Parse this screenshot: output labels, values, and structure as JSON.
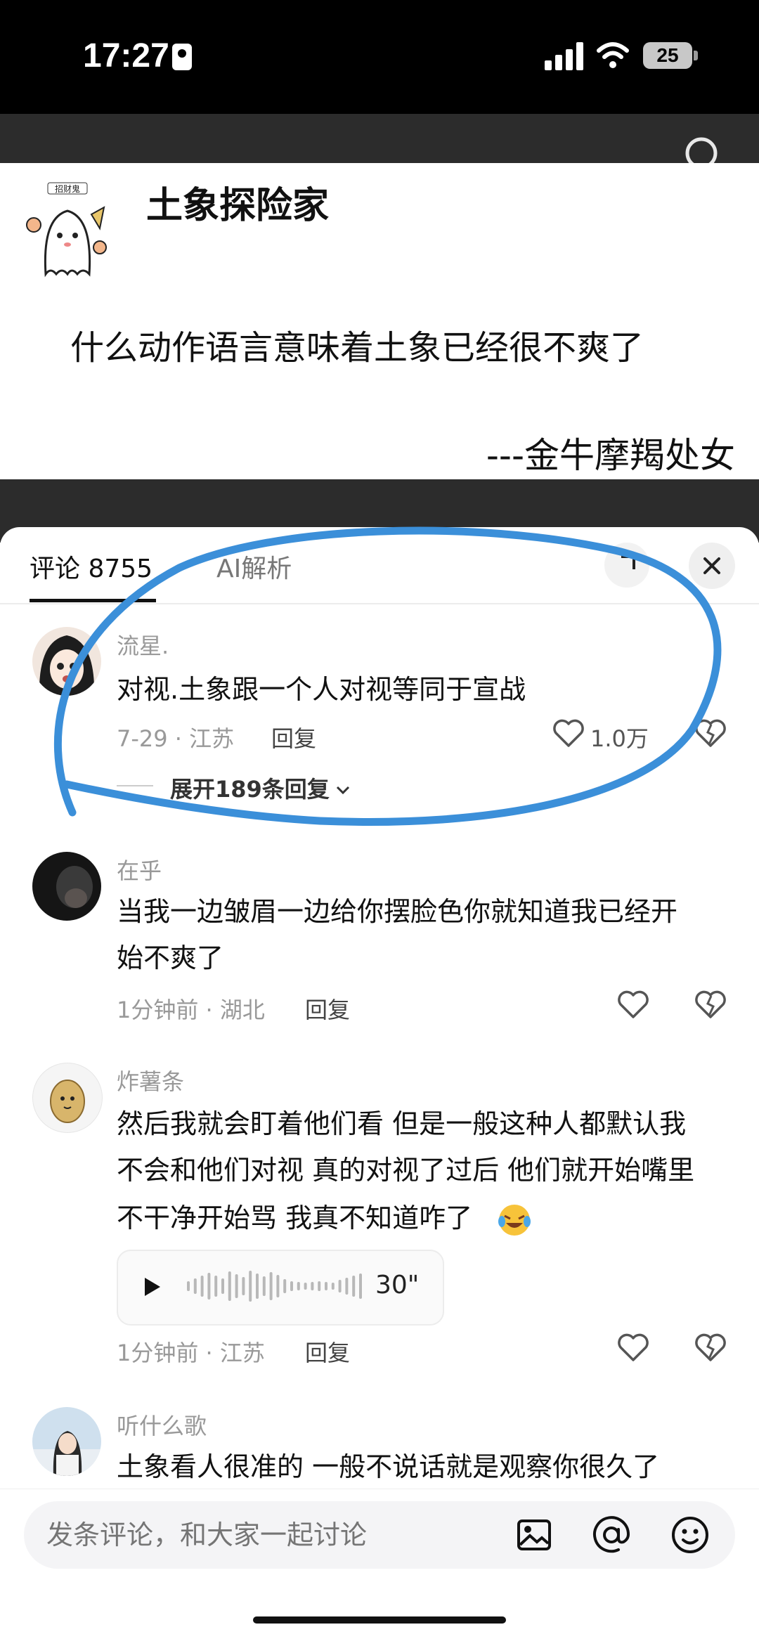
{
  "status_bar": {
    "time": "17:27",
    "battery": "25"
  },
  "post": {
    "author": "土象探险家",
    "avatar_label": "招财鬼",
    "text": "什么动作语言意味着土象已经很不爽了",
    "signature": "---金牛摩羯处女"
  },
  "sheet": {
    "tabs": [
      {
        "label": "评论 8755"
      },
      {
        "label": "AI解析"
      }
    ]
  },
  "comments": [
    {
      "username": "流星.",
      "text": "对视.土象跟一个人对视等同于宣战",
      "time_location": "7-29 · 江苏",
      "reply_label": "回复",
      "likes": "1.0万",
      "expand_label": "展开189条回复"
    },
    {
      "username": "在乎",
      "text_lines": [
        "当我一边皱眉一边给你摆脸色你就知道我已经开",
        "始不爽了"
      ],
      "time_location": "1分钟前 · 湖北",
      "reply_label": "回复"
    },
    {
      "username": "炸薯条",
      "text_lines": [
        "然后我就会盯着他们看 但是一般这种人都默认我",
        "不会和他们对视 真的对视了过后 他们就开始嘴里",
        "不干净开始骂 我真不知道咋了"
      ],
      "voice_duration": "30\"",
      "time_location": "1分钟前 · 江苏",
      "reply_label": "回复"
    },
    {
      "username": "听什么歌",
      "text": "土象看人很准的 一般不说话就是观察你很久了"
    }
  ],
  "input": {
    "placeholder": "发条评论，和大家一起讨论"
  },
  "icons": {
    "search": "search-icon",
    "close": "close-icon",
    "heart": "heart-icon",
    "dislike": "broken-heart-icon",
    "image": "image-icon",
    "mention": "at-icon",
    "emoji": "emoji-icon",
    "play": "play-icon"
  },
  "colors": {
    "annotation_circle": "#3b8fd9"
  }
}
